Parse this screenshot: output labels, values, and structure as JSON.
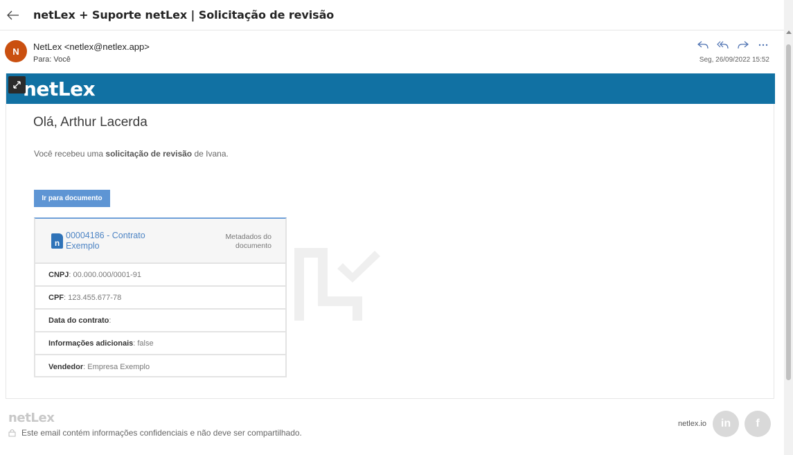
{
  "header": {
    "subject": "netLex + Suporte netLex | Solicitação de revisão"
  },
  "sender": {
    "initial": "N",
    "from": "NetLex <netlex@netlex.app>",
    "to_label": "Para:",
    "to_value": "Você",
    "date": "Seg, 26/09/2022 15:52"
  },
  "email": {
    "brand": "netLex",
    "greeting": "Olá, Arthur Lacerda",
    "message_prefix": "Você recebeu uma ",
    "message_bold": "solicitação de revisão",
    "message_suffix": " de Ivana.",
    "cta_label": "Ir para documento",
    "card": {
      "doc_icon_letter": "n",
      "doc_title": "00004186 - Contrato Exemplo",
      "meta_label": "Metadados do documento",
      "fields": [
        {
          "label": "CNPJ",
          "value": ": 00.000.000/0001-91"
        },
        {
          "label": "CPF",
          "value": ": 123.455.677-78"
        },
        {
          "label": "Data do contrato",
          "value": ":"
        },
        {
          "label": "Informações adicionais",
          "value": ": false"
        },
        {
          "label": "Vendedor",
          "value": ": Empresa Exemplo"
        }
      ]
    }
  },
  "footer": {
    "brand": "netLex",
    "note": "Este email contém informações confidenciais e não deve ser compartilhado.",
    "site": "netlex.io",
    "linkedin": "in",
    "facebook": "f"
  },
  "colors": {
    "banner": "#1171a3",
    "avatar": "#ca5010",
    "cta": "#5e95d4",
    "link": "#4d84c4"
  }
}
